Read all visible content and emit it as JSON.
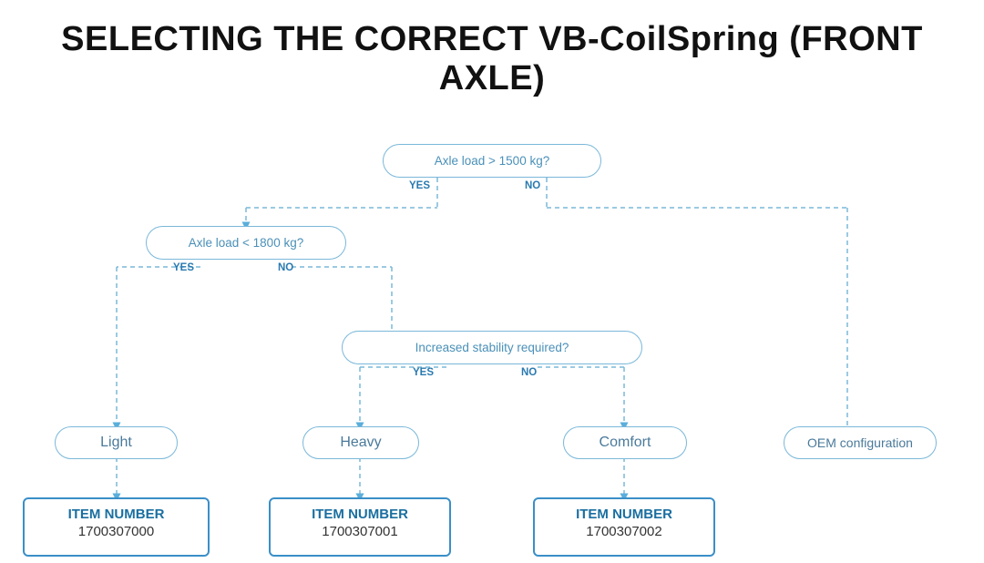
{
  "title": {
    "line1": "SELECTING THE CORRECT VB-CoilSpring (FRONT AXLE)"
  },
  "decisions": {
    "d1": {
      "text": "Axle load > 1500 kg?"
    },
    "d2": {
      "text": "Axle load < 1800 kg?"
    },
    "d3": {
      "text": "Increased stability required?"
    }
  },
  "results": {
    "r1": {
      "text": "Light"
    },
    "r2": {
      "text": "Heavy"
    },
    "r3": {
      "text": "Comfort"
    },
    "r4": {
      "text": "OEM configuration"
    }
  },
  "items": {
    "i1": {
      "label": "ITEM NUMBER",
      "number": "1700307000"
    },
    "i2": {
      "label": "ITEM NUMBER",
      "number": "1700307001"
    },
    "i3": {
      "label": "ITEM NUMBER",
      "number": "1700307002"
    }
  },
  "labels": {
    "yes": "YES",
    "no": "NO"
  }
}
